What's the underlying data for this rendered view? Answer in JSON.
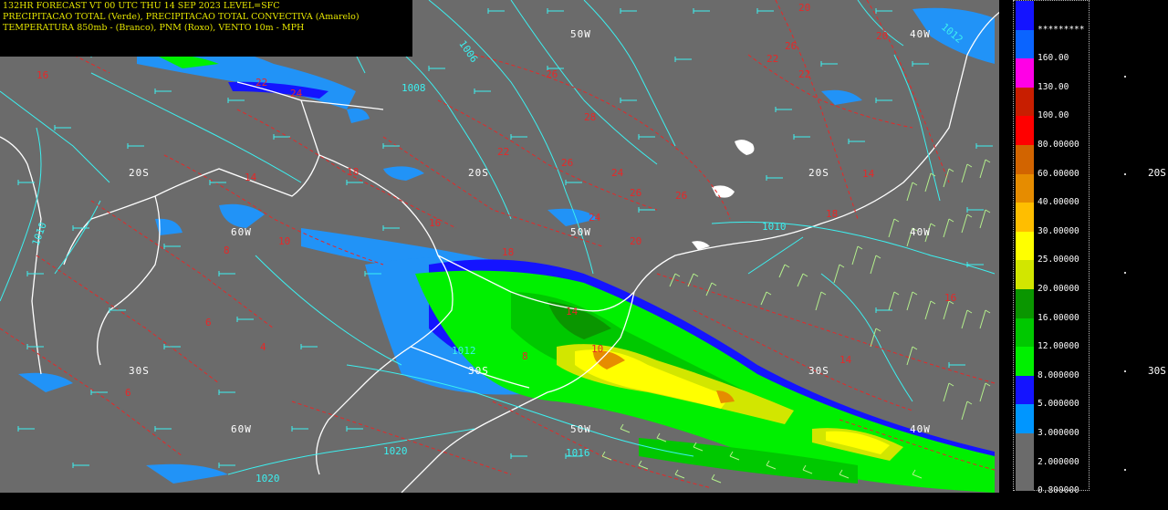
{
  "title": {
    "line1": "132HR FORECAST   VT 00 UTC THU 14 SEP 2023    LEVEL=SFC",
    "line2": "PRECIPITACAO TOTAL (Verde), PRECIPITACAO TOTAL CONVECTIVA (Amarelo)",
    "line3": "TEMPERATURA 850mb - (Branco), PNM (Roxo), VENTO 10m - MPH"
  },
  "grid_labels": [
    {
      "text": "50W"
    },
    {
      "text": "40W"
    },
    {
      "text": "20S"
    },
    {
      "text": "20S"
    },
    {
      "text": "20S"
    },
    {
      "text": "60W"
    },
    {
      "text": "50W"
    },
    {
      "text": "40W"
    },
    {
      "text": "30S"
    },
    {
      "text": "30S"
    },
    {
      "text": "30S"
    },
    {
      "text": "60W"
    },
    {
      "text": "50W"
    },
    {
      "text": "40W"
    }
  ],
  "edge_labels": [
    {
      "text": "20S"
    },
    {
      "text": "30S"
    }
  ],
  "isobar_labels": [
    "1006",
    "1008",
    "1010",
    "1012",
    "1020",
    "1020",
    "1016",
    "1010",
    "1012"
  ],
  "temp_labels": [
    "20",
    "22",
    "26",
    "22",
    "26",
    "28",
    "22",
    "26",
    "24",
    "26",
    "26",
    "24",
    "20",
    "14",
    "18",
    "18",
    "16",
    "14",
    "16",
    "18",
    "14",
    "10",
    "8",
    "6",
    "6",
    "4",
    "8",
    "10",
    "14",
    "16",
    "20",
    "22",
    "24"
  ],
  "legend": {
    "top_label": "*********",
    "entries": [
      {
        "label": "160.00",
        "color": "#0a64ff"
      },
      {
        "label": "130.00",
        "color": "#ff00e6"
      },
      {
        "label": "100.00",
        "color": "#c81e00"
      },
      {
        "label": "80.00000",
        "color": "#ff0000"
      },
      {
        "label": "60.00000",
        "color": "#d26400"
      },
      {
        "label": "40.00000",
        "color": "#e68c00"
      },
      {
        "label": "30.00000",
        "color": "#ffbe00"
      },
      {
        "label": "25.00000",
        "color": "#ffff00"
      },
      {
        "label": "20.00000",
        "color": "#d2e600"
      },
      {
        "label": "16.00000",
        "color": "#0a9600"
      },
      {
        "label": "12.00000",
        "color": "#00c800"
      },
      {
        "label": "8.000000",
        "color": "#00f000"
      },
      {
        "label": "5.000000",
        "color": "#1414ff"
      },
      {
        "label": "3.000000",
        "color": "#0096ff"
      },
      {
        "label": "2.000000",
        "color": "#6b6b6b"
      },
      {
        "label": "0.800000",
        "color": "#6b6b6b"
      }
    ],
    "top_color": "#1414ff"
  }
}
